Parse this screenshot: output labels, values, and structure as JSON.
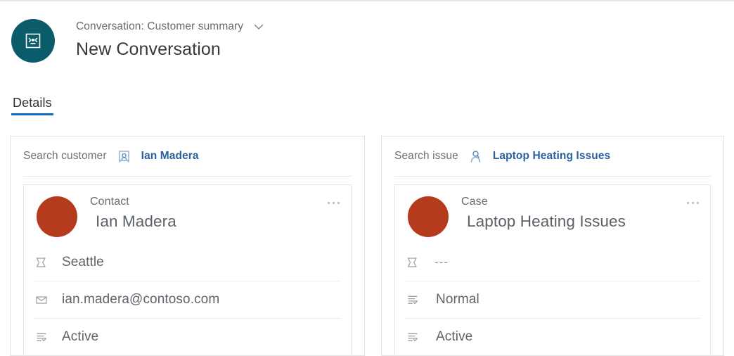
{
  "header": {
    "entity_icon": "conversation-icon",
    "breadcrumb": "Conversation: Customer summary",
    "chevron_icon": "chevron-down-icon",
    "title": "New Conversation",
    "avatar_color": "#0b5c6b"
  },
  "tabs": [
    {
      "label": "Details",
      "selected": true,
      "accent": "#0f6cbd"
    }
  ],
  "panels": [
    {
      "search": {
        "label": "Search customer",
        "icon": "contact-card-icon",
        "value": "Ian Madera",
        "value_color": "#2b5f9e"
      },
      "record": {
        "avatar_color": "#b43c1d",
        "type": "Contact",
        "name": "Ian Madera",
        "overflow_icon": "more-options-icon",
        "attributes": [
          {
            "icon": "location-icon",
            "value": "Seattle"
          },
          {
            "icon": "email-icon",
            "value": "ian.madera@contoso.com"
          },
          {
            "icon": "status-icon",
            "value": "Active"
          }
        ]
      }
    },
    {
      "search": {
        "label": "Search issue",
        "icon": "case-person-icon",
        "value": "Laptop Heating Issues",
        "value_color": "#2b5f9e"
      },
      "record": {
        "avatar_color": "#b43c1d",
        "type": "Case",
        "name": "Laptop Heating Issues",
        "overflow_icon": "more-options-icon",
        "attributes": [
          {
            "icon": "location-icon",
            "value": "---"
          },
          {
            "icon": "status-icon",
            "value": "Normal"
          },
          {
            "icon": "status-icon",
            "value": "Active"
          }
        ]
      }
    }
  ]
}
